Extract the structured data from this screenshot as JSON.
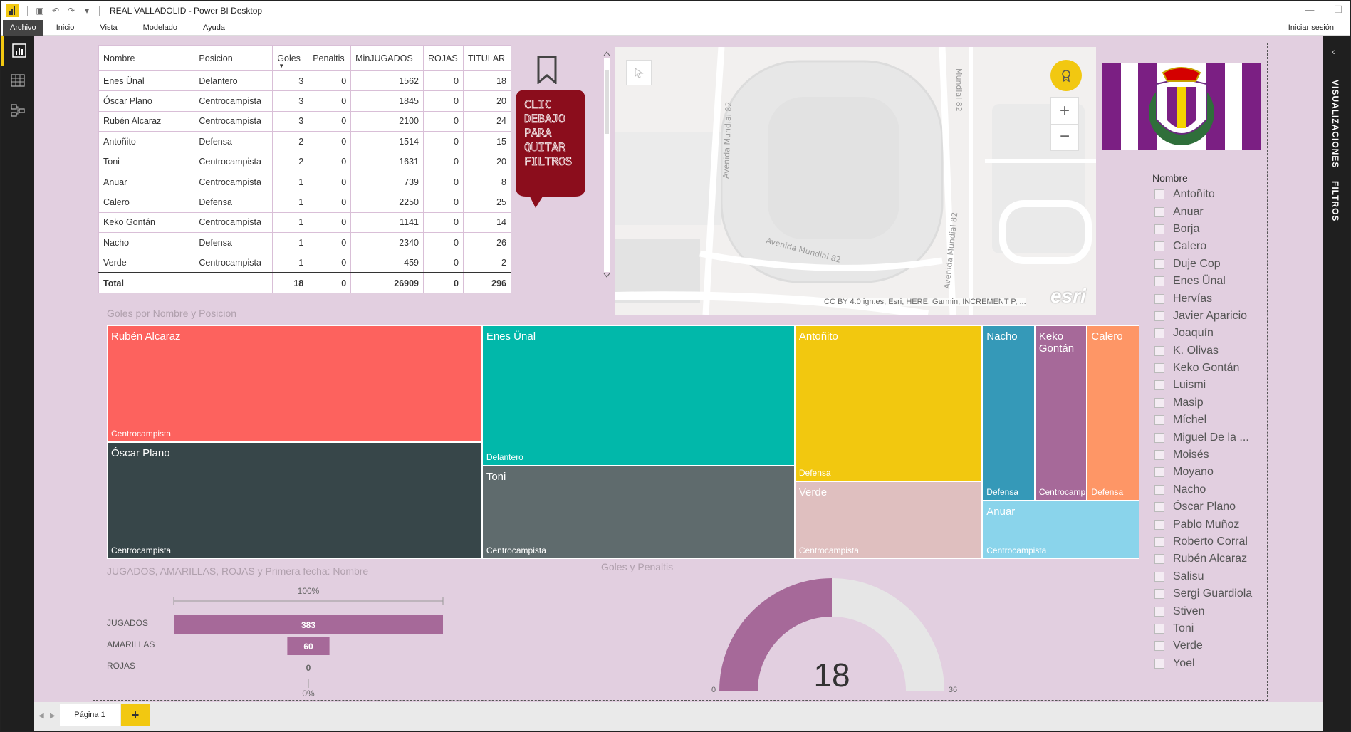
{
  "window": {
    "title": "REAL VALLADOLID - Power BI Desktop"
  },
  "menu": {
    "items": [
      "Archivo",
      "Inicio",
      "Vista",
      "Modelado",
      "Ayuda"
    ],
    "signin": "Iniciar sesión"
  },
  "table": {
    "headers": [
      "Nombre",
      "Posicion",
      "Goles",
      "Penaltis",
      "MinJUGADOS",
      "ROJAS",
      "TITULAR"
    ],
    "rows": [
      [
        "Enes Ünal",
        "Delantero",
        "3",
        "0",
        "1562",
        "0",
        "18"
      ],
      [
        "Óscar Plano",
        "Centrocampista",
        "3",
        "0",
        "1845",
        "0",
        "20"
      ],
      [
        "Rubén Alcaraz",
        "Centrocampista",
        "3",
        "0",
        "2100",
        "0",
        "24"
      ],
      [
        "Antoñito",
        "Defensa",
        "2",
        "0",
        "1514",
        "0",
        "15"
      ],
      [
        "Toni",
        "Centrocampista",
        "2",
        "0",
        "1631",
        "0",
        "20"
      ],
      [
        "Anuar",
        "Centrocampista",
        "1",
        "0",
        "739",
        "0",
        "8"
      ],
      [
        "Calero",
        "Defensa",
        "1",
        "0",
        "2250",
        "0",
        "25"
      ],
      [
        "Keko Gontán",
        "Centrocampista",
        "1",
        "0",
        "1141",
        "0",
        "14"
      ],
      [
        "Nacho",
        "Defensa",
        "1",
        "0",
        "2340",
        "0",
        "26"
      ],
      [
        "Verde",
        "Centrocampista",
        "1",
        "0",
        "459",
        "0",
        "2"
      ]
    ],
    "total": [
      "Total",
      "",
      "18",
      "0",
      "26909",
      "0",
      "296"
    ]
  },
  "bubble": {
    "lines": [
      "CLIC",
      "DEBAJO",
      "PARA",
      "QUITAR",
      "FILTROS"
    ]
  },
  "map": {
    "attribution": "CC BY 4.0 ign.es, Esri, HERE, Garmin, INCREMENT P, ...",
    "brand": "esri",
    "streets": [
      "Avenida Mundial 82",
      "Avenida Mundial 82",
      "Avenida Mundial 82",
      "Mundial 82"
    ]
  },
  "slicer": {
    "title": "Nombre",
    "items": [
      "Antoñito",
      "Anuar",
      "Borja",
      "Calero",
      "Duje Cop",
      "Enes Ünal",
      "Hervías",
      "Javier Aparicio",
      "Joaquín",
      "K. Olivas",
      "Keko Gontán",
      "Luismi",
      "Masip",
      "Míchel",
      "Miguel De la ...",
      "Moisés",
      "Moyano",
      "Nacho",
      "Óscar Plano",
      "Pablo Muñoz",
      "Roberto Corral",
      "Rubén Alcaraz",
      "Salisu",
      "Sergi Guardiola",
      "Stiven",
      "Toni",
      "Verde",
      "Yoel"
    ]
  },
  "rightpane": {
    "visualizaciones": "VISUALIZACIONES",
    "filtros": "FILTROS"
  },
  "treemap_title": "Goles por Nombre y Posicion",
  "bars_title": "JUGADOS, AMARILLAS, ROJAS y Primera fecha: Nombre",
  "gauge_title": "Goles y Penaltis",
  "pages": {
    "tab": "Página 1",
    "add": "+"
  },
  "chart_data": [
    {
      "type": "treemap",
      "title": "Goles por Nombre y Posicion",
      "groups": [
        {
          "name": "Rubén Alcaraz",
          "position": "Centrocampista",
          "value": 3,
          "color": "#fd625e"
        },
        {
          "name": "Óscar Plano",
          "position": "Centrocampista",
          "value": 3,
          "color": "#374649"
        },
        {
          "name": "Enes Ünal",
          "position": "Delantero",
          "value": 3,
          "color": "#01b8aa"
        },
        {
          "name": "Toni",
          "position": "Centrocampista",
          "value": 2,
          "color": "#5f6b6d"
        },
        {
          "name": "Antoñito",
          "position": "Defensa",
          "value": 2,
          "color": "#f2c80f"
        },
        {
          "name": "Verde",
          "position": "Centrocampista",
          "value": 1,
          "color": "#dfbfbf"
        },
        {
          "name": "Nacho",
          "position": "Defensa",
          "value": 1,
          "color": "#3599b8"
        },
        {
          "name": "Keko Gontán",
          "position": "Centrocampista",
          "value": 1,
          "color": "#a66999"
        },
        {
          "name": "Calero",
          "position": "Defensa",
          "value": 1,
          "color": "#fe9666"
        },
        {
          "name": "Anuar",
          "position": "Centrocampista",
          "value": 1,
          "color": "#8ad4eb"
        }
      ]
    },
    {
      "type": "bar",
      "title": "JUGADOS, AMARILLAS, ROJAS y Primera fecha: Nombre",
      "categories": [
        "JUGADOS",
        "AMARILLAS",
        "ROJAS"
      ],
      "values": [
        383,
        60,
        0
      ],
      "labels": [
        "383",
        "60",
        "0"
      ],
      "top_label": "100%",
      "bottom_label": "0%",
      "max": 383,
      "color": "#a66999"
    },
    {
      "type": "gauge",
      "title": "Goles y Penaltis",
      "value": 18,
      "value_label": "18",
      "min": 0,
      "max": 36,
      "min_label": "0",
      "max_label": "36",
      "fill_color": "#a66999",
      "track_color": "#e6e6e6"
    }
  ]
}
